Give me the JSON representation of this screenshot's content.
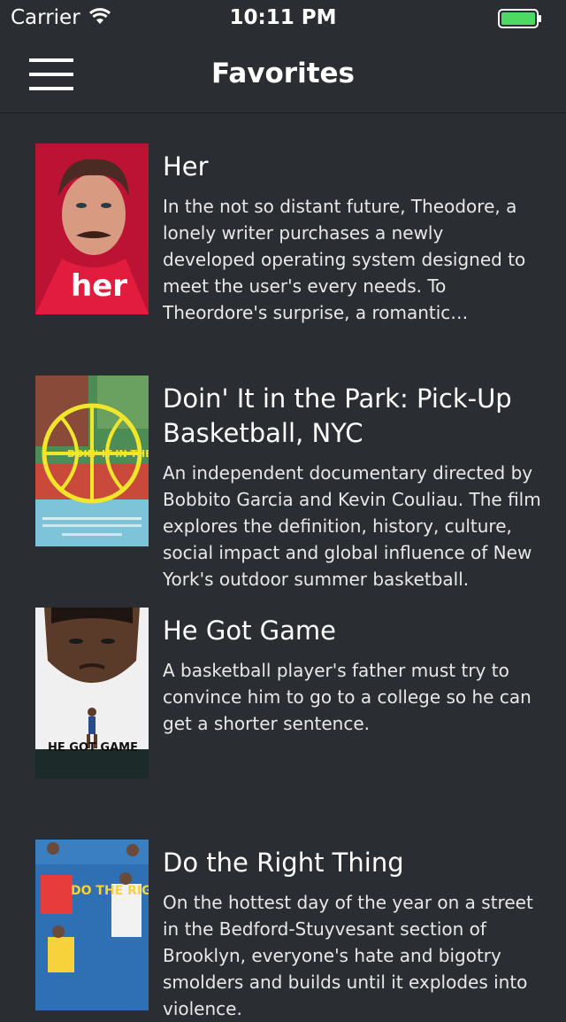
{
  "status_bar": {
    "carrier": "Carrier",
    "time": "10:11 PM",
    "battery_color": "#4cd964"
  },
  "nav": {
    "title": "Favorites",
    "menu_icon": "hamburger-menu-icon"
  },
  "movies": [
    {
      "title": "Her",
      "description": "In the not so distant future, Theodore, a lonely writer purchases a newly developed operating system designed to meet the user's every needs. To Theordore's surprise, a romantic relationship develops with the OS.",
      "poster_text": "her",
      "poster_bg": "#c8173a"
    },
    {
      "title": "Doin' It in the Park: Pick-Up Basketball, NYC",
      "description": "An independent documentary directed by Bobbito Garcia and Kevin Couliau. The film explores the definition, history, culture, social impact and global influence of New York's outdoor summer basketball.",
      "poster_text": "DOIN' IT IN THE PARK",
      "poster_bg": "#3d8a4a"
    },
    {
      "title": "He Got Game",
      "description": "A basketball player's father must try to convince him to go to a college so he can get a shorter sentence.",
      "poster_text": "HE GOT GAME",
      "poster_bg": "#eeeeee"
    },
    {
      "title": "Do the Right Thing",
      "description": "On the hottest day of the year on a street in the Bedford-Stuyvesant section of Brooklyn, everyone's hate and bigotry smolders and builds until it explodes into violence.",
      "poster_text": "DO THE RIGHT THING",
      "poster_bg": "#2f6fb3"
    }
  ]
}
